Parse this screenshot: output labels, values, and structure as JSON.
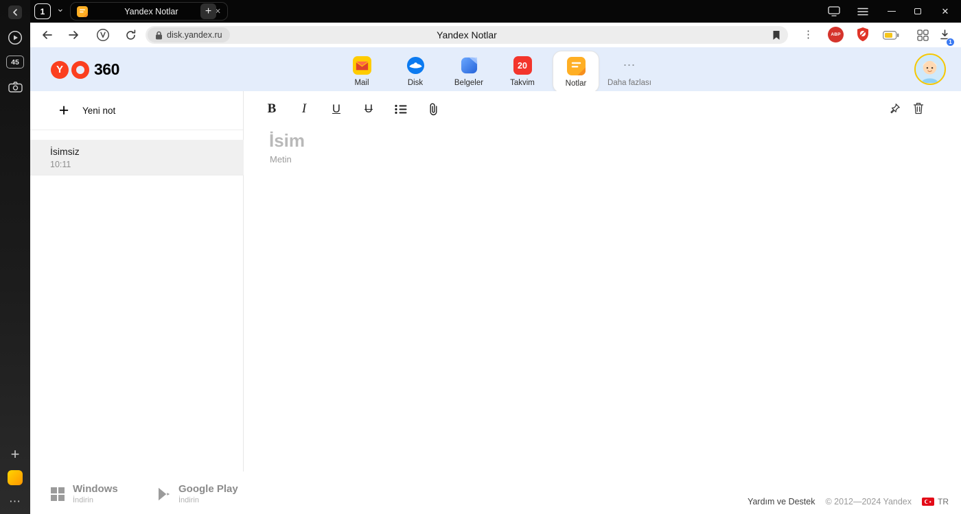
{
  "window": {
    "tab_counter": "1",
    "tab_title": "Yandex Notlar",
    "page_title": "Yandex Notlar",
    "address": "disk.yandex.ru",
    "abp_badge": "ABP",
    "download_badge": "1",
    "sidebar_badge": "45"
  },
  "icons": {
    "close": "✕",
    "plus": "+",
    "chevron": "⌄",
    "kebab": "⋮",
    "more_h": "⋯"
  },
  "header": {
    "logo_y": "Y",
    "logo_text": "360",
    "services": [
      {
        "label": "Mail"
      },
      {
        "label": "Disk"
      },
      {
        "label": "Belgeler"
      },
      {
        "label": "Takvim",
        "badge": "20"
      },
      {
        "label": "Notlar"
      },
      {
        "label": "Daha fazlası"
      }
    ]
  },
  "notes": {
    "new_note": "Yeni not",
    "items": [
      {
        "title": "İsimsiz",
        "time": "10:11"
      }
    ]
  },
  "editor": {
    "toolbar": {
      "bold": "B",
      "italic": "I",
      "underline": "U",
      "strikethrough": "U"
    },
    "title_placeholder": "İsim",
    "body_placeholder": "Metin"
  },
  "footer": {
    "windows_title": "Windows",
    "windows_subtitle": "İndirin",
    "gplay_title": "Google Play",
    "gplay_subtitle": "İndirin",
    "help": "Yardım ve Destek",
    "copyright": "© 2012—2024 Yandex",
    "lang": "TR"
  }
}
